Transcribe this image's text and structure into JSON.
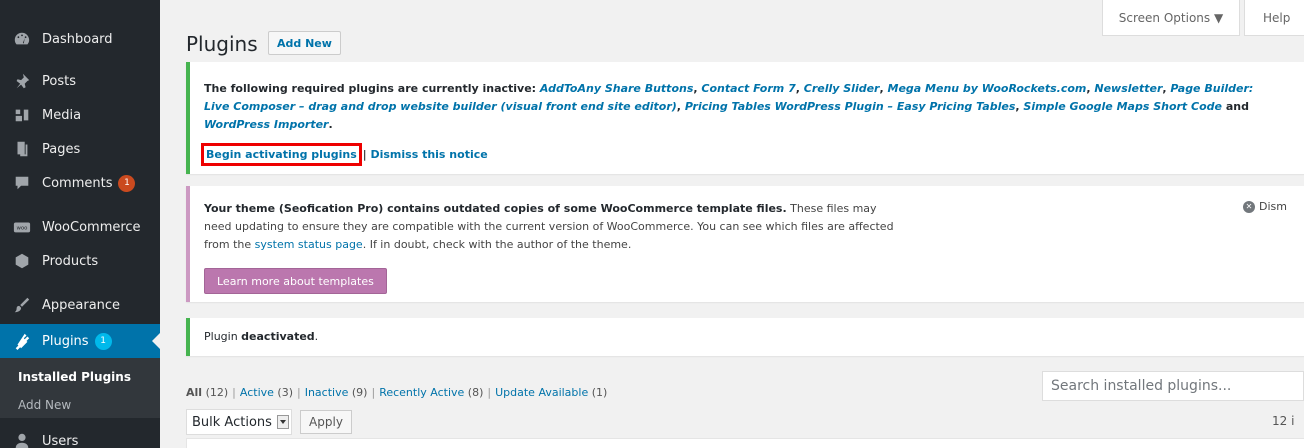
{
  "sidebar": {
    "items": [
      {
        "label": "Dashboard",
        "icon": "dashboard-icon"
      },
      {
        "label": "Posts",
        "icon": "pin-icon"
      },
      {
        "label": "Media",
        "icon": "media-icon"
      },
      {
        "label": "Pages",
        "icon": "pages-icon"
      },
      {
        "label": "Comments",
        "icon": "comment-icon",
        "badge": "1"
      },
      {
        "label": "WooCommerce",
        "icon": "woocommerce-icon"
      },
      {
        "label": "Products",
        "icon": "products-icon"
      },
      {
        "label": "Appearance",
        "icon": "brush-icon"
      },
      {
        "label": "Plugins",
        "icon": "plugin-icon",
        "badge": "1"
      },
      {
        "label": "Users",
        "icon": "users-icon"
      }
    ],
    "submenu": {
      "current": "Installed Plugins",
      "add_new": "Add New"
    }
  },
  "header": {
    "screen_options": "Screen Options ▼",
    "help": "Help",
    "title": "Plugins",
    "add_new": "Add New"
  },
  "notice_required": {
    "intro": "The following required plugins are currently inactive: ",
    "plugins": [
      "AddToAny Share Buttons",
      "Contact Form 7",
      "Crelly Slider",
      "Mega Menu by WooRockets.com",
      "Newsletter",
      "Page Builder: Live Composer – drag and drop website builder (visual front end site editor)",
      "Pricing Tables WordPress Plugin – Easy Pricing Tables",
      "Simple Google Maps Short Code",
      "WordPress Importer"
    ],
    "and_word": " and ",
    "begin": "Begin activating plugins",
    "separator": " | ",
    "dismiss": "Dismiss this notice"
  },
  "notice_woo": {
    "strong": "Your theme (Seofication Pro) contains outdated copies of some WooCommerce template files.",
    "text1": " These files may need updating to ensure they are compatible with the current version of WooCommerce. You can see which files are affected from the ",
    "link": "system status page",
    "text2": ". If in doubt, check with the author of the theme.",
    "button": "Learn more about templates",
    "dismiss": "Dism"
  },
  "notice_deactivated": {
    "prefix": "Plugin ",
    "strong": "deactivated",
    "suffix": "."
  },
  "filters": [
    {
      "label": "All",
      "count": "(12)",
      "current": true
    },
    {
      "label": "Active",
      "count": "(3)"
    },
    {
      "label": "Inactive",
      "count": "(9)"
    },
    {
      "label": "Recently Active",
      "count": "(8)"
    },
    {
      "label": "Update Available",
      "count": "(1)"
    }
  ],
  "search": {
    "placeholder": "Search installed plugins..."
  },
  "bulk": {
    "selected": "Bulk Actions",
    "apply": "Apply"
  },
  "items_count": "12 i",
  "colors": {
    "sidebar": "#23282d",
    "active": "#0073aa",
    "link": "#0073aa",
    "woo_purple": "#bb77ae",
    "highlight": "#e00000"
  }
}
